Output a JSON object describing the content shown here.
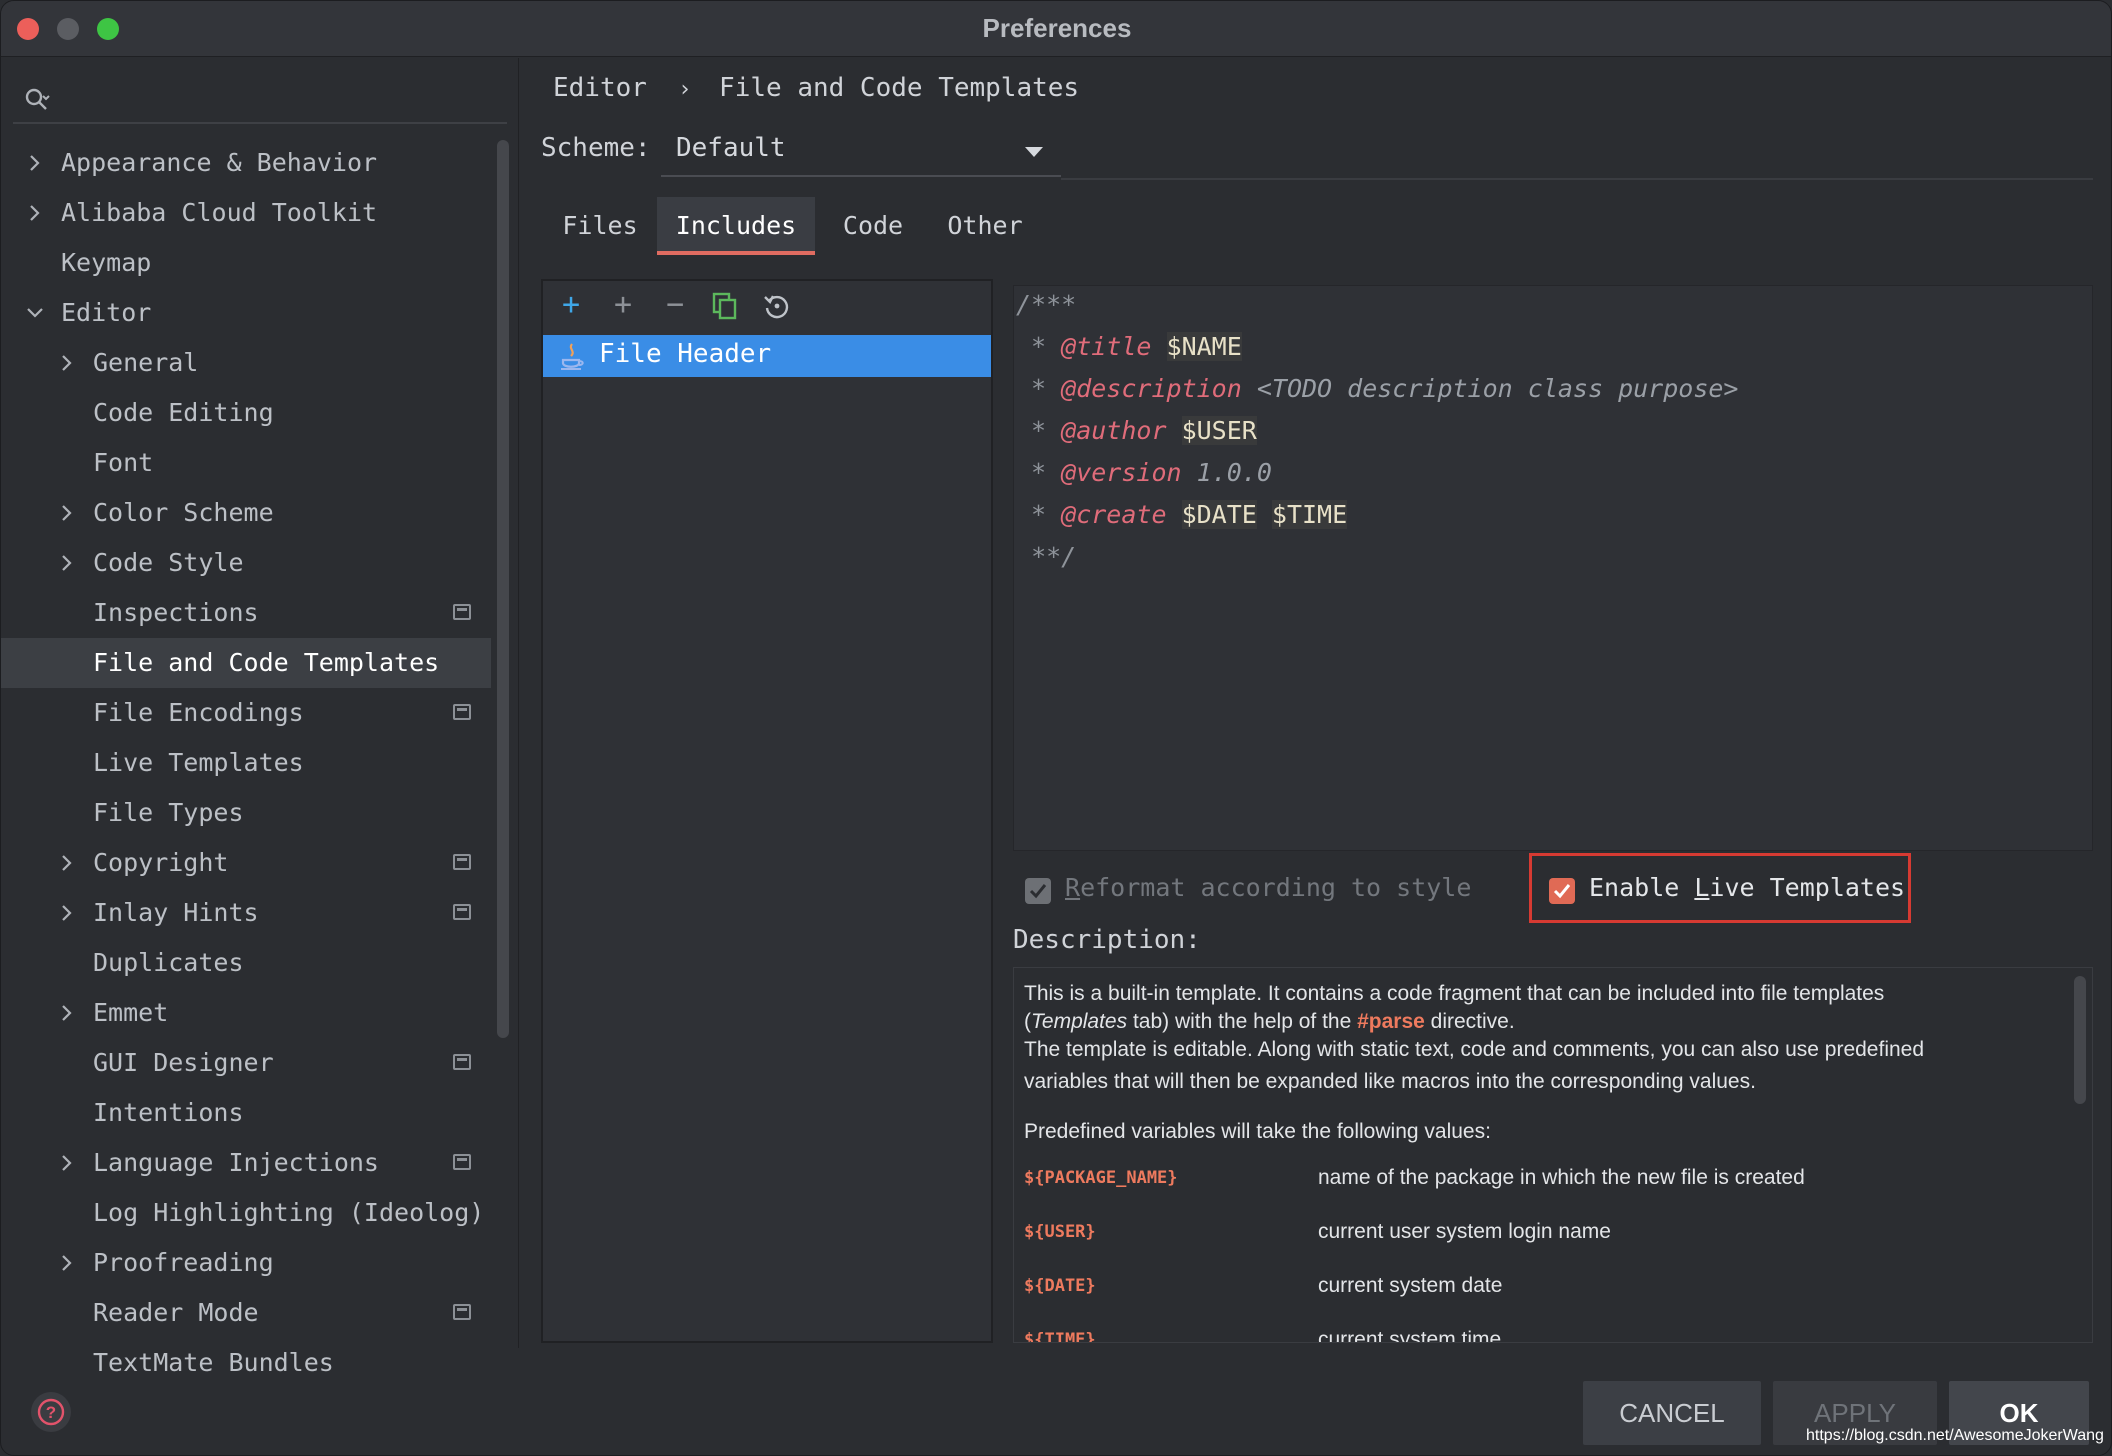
{
  "window": {
    "title": "Preferences"
  },
  "search": {
    "placeholder": ""
  },
  "sidebar": {
    "items": [
      {
        "label": "Appearance & Behavior",
        "level": 0,
        "expandable": true,
        "expanded": false,
        "selected": false,
        "project_icon": false
      },
      {
        "label": "Alibaba Cloud Toolkit",
        "level": 0,
        "expandable": true,
        "expanded": false,
        "selected": false,
        "project_icon": false
      },
      {
        "label": "Keymap",
        "level": 0,
        "expandable": false,
        "expanded": false,
        "selected": false,
        "project_icon": false
      },
      {
        "label": "Editor",
        "level": 0,
        "expandable": true,
        "expanded": true,
        "selected": false,
        "project_icon": false
      },
      {
        "label": "General",
        "level": 1,
        "expandable": true,
        "expanded": false,
        "selected": false,
        "project_icon": false
      },
      {
        "label": "Code Editing",
        "level": 1,
        "expandable": false,
        "expanded": false,
        "selected": false,
        "project_icon": false
      },
      {
        "label": "Font",
        "level": 1,
        "expandable": false,
        "expanded": false,
        "selected": false,
        "project_icon": false
      },
      {
        "label": "Color Scheme",
        "level": 1,
        "expandable": true,
        "expanded": false,
        "selected": false,
        "project_icon": false
      },
      {
        "label": "Code Style",
        "level": 1,
        "expandable": true,
        "expanded": false,
        "selected": false,
        "project_icon": false
      },
      {
        "label": "Inspections",
        "level": 1,
        "expandable": false,
        "expanded": false,
        "selected": false,
        "project_icon": true
      },
      {
        "label": "File and Code Templates",
        "level": 1,
        "expandable": false,
        "expanded": false,
        "selected": true,
        "project_icon": false
      },
      {
        "label": "File Encodings",
        "level": 1,
        "expandable": false,
        "expanded": false,
        "selected": false,
        "project_icon": true
      },
      {
        "label": "Live Templates",
        "level": 1,
        "expandable": false,
        "expanded": false,
        "selected": false,
        "project_icon": false
      },
      {
        "label": "File Types",
        "level": 1,
        "expandable": false,
        "expanded": false,
        "selected": false,
        "project_icon": false
      },
      {
        "label": "Copyright",
        "level": 1,
        "expandable": true,
        "expanded": false,
        "selected": false,
        "project_icon": true
      },
      {
        "label": "Inlay Hints",
        "level": 1,
        "expandable": true,
        "expanded": false,
        "selected": false,
        "project_icon": true
      },
      {
        "label": "Duplicates",
        "level": 1,
        "expandable": false,
        "expanded": false,
        "selected": false,
        "project_icon": false
      },
      {
        "label": "Emmet",
        "level": 1,
        "expandable": true,
        "expanded": false,
        "selected": false,
        "project_icon": false
      },
      {
        "label": "GUI Designer",
        "level": 1,
        "expandable": false,
        "expanded": false,
        "selected": false,
        "project_icon": true
      },
      {
        "label": "Intentions",
        "level": 1,
        "expandable": false,
        "expanded": false,
        "selected": false,
        "project_icon": false
      },
      {
        "label": "Language Injections",
        "level": 1,
        "expandable": true,
        "expanded": false,
        "selected": false,
        "project_icon": true
      },
      {
        "label": "Log Highlighting (Ideolog)",
        "level": 1,
        "expandable": false,
        "expanded": false,
        "selected": false,
        "project_icon": false
      },
      {
        "label": "Proofreading",
        "level": 1,
        "expandable": true,
        "expanded": false,
        "selected": false,
        "project_icon": false
      },
      {
        "label": "Reader Mode",
        "level": 1,
        "expandable": false,
        "expanded": false,
        "selected": false,
        "project_icon": true
      },
      {
        "label": "TextMate Bundles",
        "level": 1,
        "expandable": false,
        "expanded": false,
        "selected": false,
        "project_icon": false
      }
    ]
  },
  "breadcrumb": {
    "parent": "Editor",
    "separator": "›",
    "current": "File and Code Templates"
  },
  "scheme": {
    "label": "Scheme:",
    "value": "Default"
  },
  "tabs": [
    {
      "label": "Files",
      "active": false
    },
    {
      "label": "Includes",
      "active": true
    },
    {
      "label": "Code",
      "active": false
    },
    {
      "label": "Other",
      "active": false
    }
  ],
  "toolbar": {
    "icons": [
      "add-icon",
      "add-icon",
      "remove-icon",
      "copy-icon",
      "reset-icon"
    ]
  },
  "template_list": {
    "items": [
      {
        "label": "File Header",
        "icon": "java-icon",
        "selected": true
      }
    ]
  },
  "editor": {
    "line1": "/***",
    "title_tag": "@title",
    "title_var": "$NAME",
    "description_tag": "@description",
    "description_text": "<TODO description class purpose>",
    "author_tag": "@author",
    "author_var": "$USER",
    "version_tag": "@version",
    "version_text": "1.0.0",
    "create_tag": "@create",
    "create_var1": "$DATE",
    "create_var2": "$TIME",
    "last_line": "**/",
    "line_prefix": " * "
  },
  "options": {
    "reformat": {
      "label_first": "R",
      "label_rest": "eformat according to style",
      "checked": true,
      "enabled": false
    },
    "live_templates": {
      "label_before": "Enable ",
      "label_mnemonic": "L",
      "label_after": "ive Templates",
      "checked": true,
      "enabled": true
    }
  },
  "description": {
    "label": "Description:",
    "p1a": "This is a built-in template. It contains a code fragment that can be included into file templates",
    "p1b_open": "(",
    "p1b_italic": "Templates",
    "p1b_mid": " tab) with the help of the ",
    "p1b_keyword": "#parse",
    "p1b_end": " directive.",
    "p2a": "The template is editable. Along with static text, code and comments, you can also use predefined",
    "p2b": "variables that will then be expanded like macros into the corresponding values.",
    "p3": "Predefined variables will take the following values:",
    "variables": [
      {
        "name": "${PACKAGE_NAME}",
        "desc": "name of the package in which the new file is created"
      },
      {
        "name": "${USER}",
        "desc": "current user system login name"
      },
      {
        "name": "${DATE}",
        "desc": "current system date"
      },
      {
        "name": "${TIME}",
        "desc": "current system time"
      }
    ]
  },
  "buttons": {
    "cancel": "CANCEL",
    "apply": "APPLY",
    "ok": "OK"
  },
  "watermark": "https://blog.csdn.net/AwesomeJokerWang",
  "colors": {
    "accent": "#3a8de6",
    "tab_underline": "#e06c61",
    "highlight_box": "#d63a32",
    "javadoc_tag": "#e06c7a",
    "variable_name": "#ee7a5e"
  }
}
